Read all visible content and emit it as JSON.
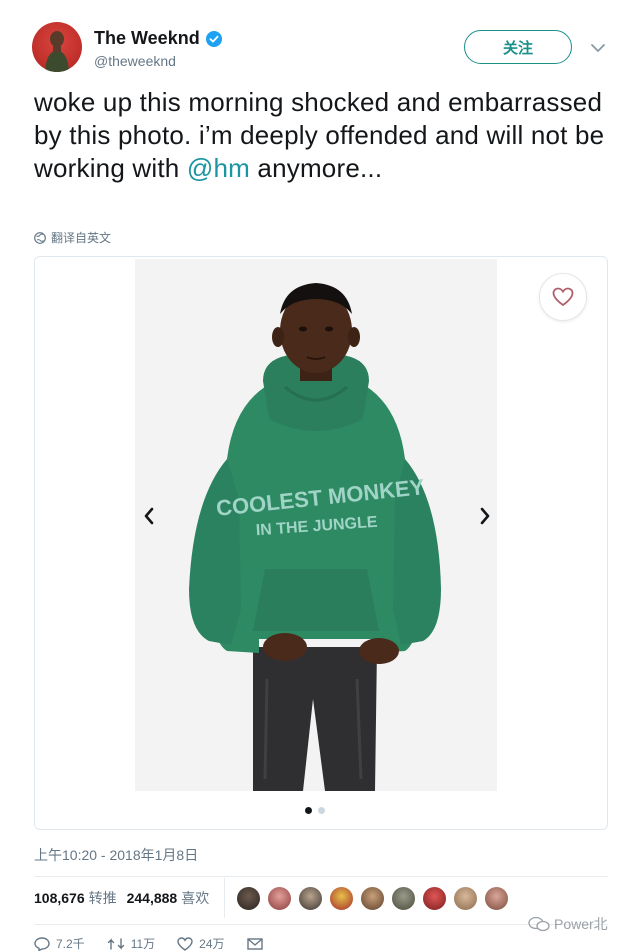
{
  "author": {
    "display_name": "The Weeknd",
    "handle": "@theweeknd"
  },
  "follow_label": "关注",
  "tweet": {
    "text_before": "woke up this morning shocked and embarrassed by this photo. i’m deeply offended and will not be working with ",
    "mention": "@hm",
    "text_after": " anymore..."
  },
  "translate_label": "翻译自英文",
  "media": {
    "shirt_line1": "COOLEST MONKEY",
    "shirt_line2": "IN THE JUNGLE",
    "dots_total": 2,
    "dots_active_index": 0
  },
  "timestamp": "上午10:20 - 2018年1月8日",
  "stats": {
    "retweets_count": "108,676",
    "retweets_label": "转推",
    "likes_count": "244,888",
    "likes_label": "喜欢"
  },
  "actions": {
    "reply_count": "7.2千",
    "retweet_count": "11万",
    "like_count": "24万"
  },
  "watermark": "Power北",
  "colors": {
    "accent": "#1b8f8a",
    "verified": "#1da1f2",
    "secondary_text": "#657786",
    "hoodie_green": "#2e8a63"
  }
}
